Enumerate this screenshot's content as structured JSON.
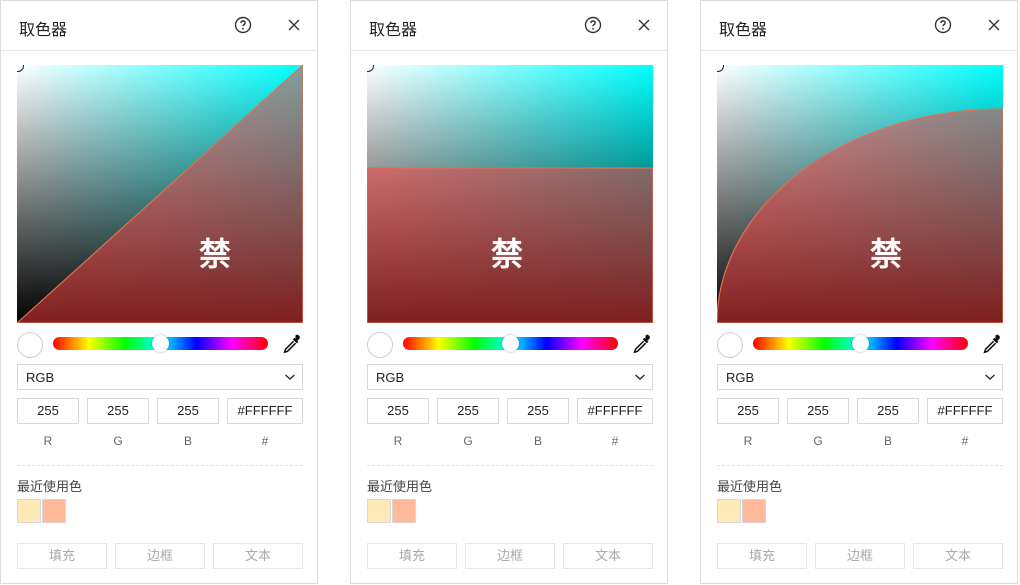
{
  "panels": [
    {
      "title": "取色器",
      "forbidden_label": "禁",
      "mode": "RGB",
      "values": {
        "r": "255",
        "g": "255",
        "b": "255",
        "hex": "#FFFFFF"
      },
      "channel_labels": [
        "R",
        "G",
        "B",
        "#"
      ],
      "recent_label": "最近使用色",
      "recent_colors": [
        "#ffe9b8",
        "#ffb899"
      ],
      "buttons": {
        "fill": "填充",
        "border": "边框",
        "text": "文本"
      },
      "hue_position": 0.5,
      "forbidden_shape": "diagonal-triangle"
    },
    {
      "title": "取色器",
      "forbidden_label": "禁",
      "mode": "RGB",
      "values": {
        "r": "255",
        "g": "255",
        "b": "255",
        "hex": "#FFFFFF"
      },
      "channel_labels": [
        "R",
        "G",
        "B",
        "#"
      ],
      "recent_label": "最近使用色",
      "recent_colors": [
        "#ffe9b8",
        "#ffb899"
      ],
      "buttons": {
        "fill": "填充",
        "border": "边框",
        "text": "文本"
      },
      "hue_position": 0.5,
      "forbidden_shape": "lower-rectangle"
    },
    {
      "title": "取色器",
      "forbidden_label": "禁",
      "mode": "RGB",
      "values": {
        "r": "255",
        "g": "255",
        "b": "255",
        "hex": "#FFFFFF"
      },
      "channel_labels": [
        "R",
        "G",
        "B",
        "#"
      ],
      "recent_label": "最近使用色",
      "recent_colors": [
        "#ffe9b8",
        "#ffb899"
      ],
      "buttons": {
        "fill": "填充",
        "border": "边框",
        "text": "文本"
      },
      "hue_position": 0.5,
      "forbidden_shape": "lower-right-quarter-circle"
    }
  ],
  "colors": {
    "hue_color": "#00ffff",
    "forbidden_overlay": "#ff3d3d",
    "forbidden_edge": "#e0704f"
  },
  "icons": {
    "help": "help-icon",
    "close": "close-icon",
    "eyedropper": "eyedropper-icon",
    "chevron": "chevron-down-icon"
  }
}
